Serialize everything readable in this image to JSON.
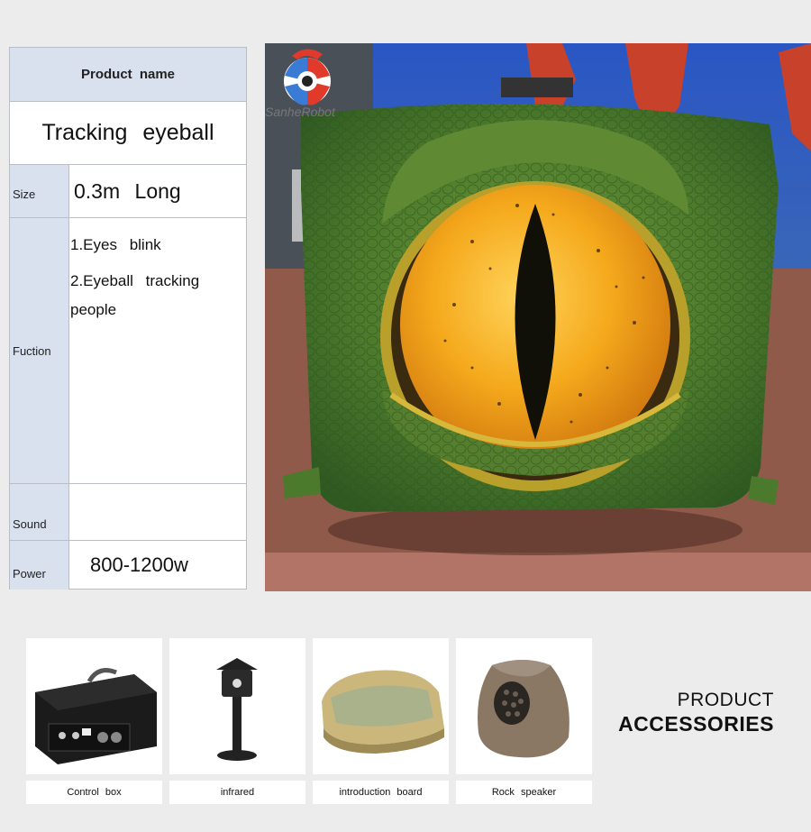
{
  "spec_table": {
    "header": "Product  name",
    "product_name": "Tracking  eyeball",
    "rows": {
      "size": {
        "label": "Size",
        "value": "0.3m   Long"
      },
      "function": {
        "label": "Fuction",
        "items": [
          "1.Eyes   blink",
          "2.Eyeball   tracking people"
        ]
      },
      "sound": {
        "label": "Sound",
        "value": ""
      },
      "power": {
        "label": "Power",
        "value": "800-1200w"
      }
    }
  },
  "photo": {
    "logo_text": "SanheRobot"
  },
  "accessories": {
    "title_line1": "PRODUCT",
    "title_line2": "ACCESSORIES",
    "items": [
      {
        "label": "Control  box"
      },
      {
        "label": "infrared"
      },
      {
        "label": "introduction  board"
      },
      {
        "label": "Rock  speaker"
      }
    ]
  },
  "colors": {
    "table_header_bg": "#d9e1ef",
    "eye_iris": "#f2a51c",
    "eye_skin": "#4f7a2c",
    "background": "#ececec"
  }
}
